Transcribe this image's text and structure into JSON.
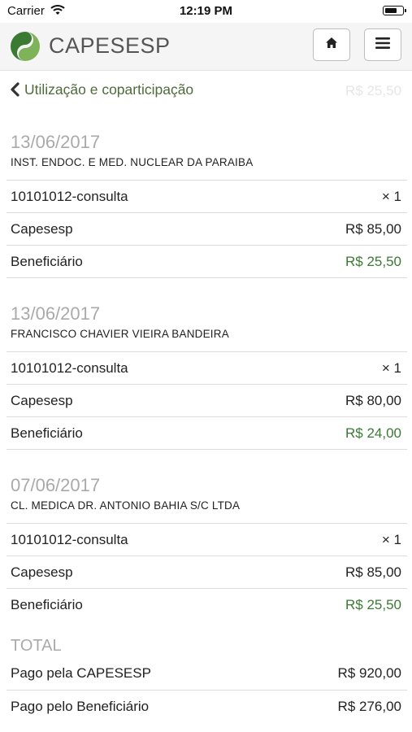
{
  "status_bar": {
    "carrier": "Carrier",
    "time": "12:19 PM"
  },
  "header": {
    "brand": "CAPESESP",
    "logo_icon": "capesesp-logo",
    "home_icon": "home-icon",
    "menu_icon": "hamburger-menu-icon",
    "accent_color": "#3a7a33"
  },
  "nav": {
    "back_label": "Utilização e coparticipação",
    "faded_value": "R$ 25,50"
  },
  "entries": [
    {
      "date": "13/06/2017",
      "provider": "INST. ENDOC. E MED. NUCLEAR DA PARAIBA",
      "procedure": "10101012-consulta",
      "quantity": "× 1",
      "capesesp_label": "Capesesp",
      "capesesp_value": "R$ 85,00",
      "beneficiario_label": "Beneficiário",
      "beneficiario_value": "R$ 25,50"
    },
    {
      "date": "13/06/2017",
      "provider": "FRANCISCO CHAVIER VIEIRA BANDEIRA",
      "procedure": "10101012-consulta",
      "quantity": "× 1",
      "capesesp_label": "Capesesp",
      "capesesp_value": "R$ 80,00",
      "beneficiario_label": "Beneficiário",
      "beneficiario_value": "R$ 24,00"
    },
    {
      "date": "07/06/2017",
      "provider": "CL. MEDICA DR. ANTONIO BAHIA S/C LTDA",
      "procedure": "10101012-consulta",
      "quantity": "× 1",
      "capesesp_label": "Capesesp",
      "capesesp_value": "R$ 85,00",
      "beneficiario_label": "Beneficiário",
      "beneficiario_value": "R$ 25,50"
    }
  ],
  "total": {
    "heading": "TOTAL",
    "rows": [
      {
        "label": "Pago pela CAPESESP",
        "value": "R$ 920,00"
      },
      {
        "label": "Pago pelo Beneficiário",
        "value": "R$ 276,00"
      }
    ]
  }
}
